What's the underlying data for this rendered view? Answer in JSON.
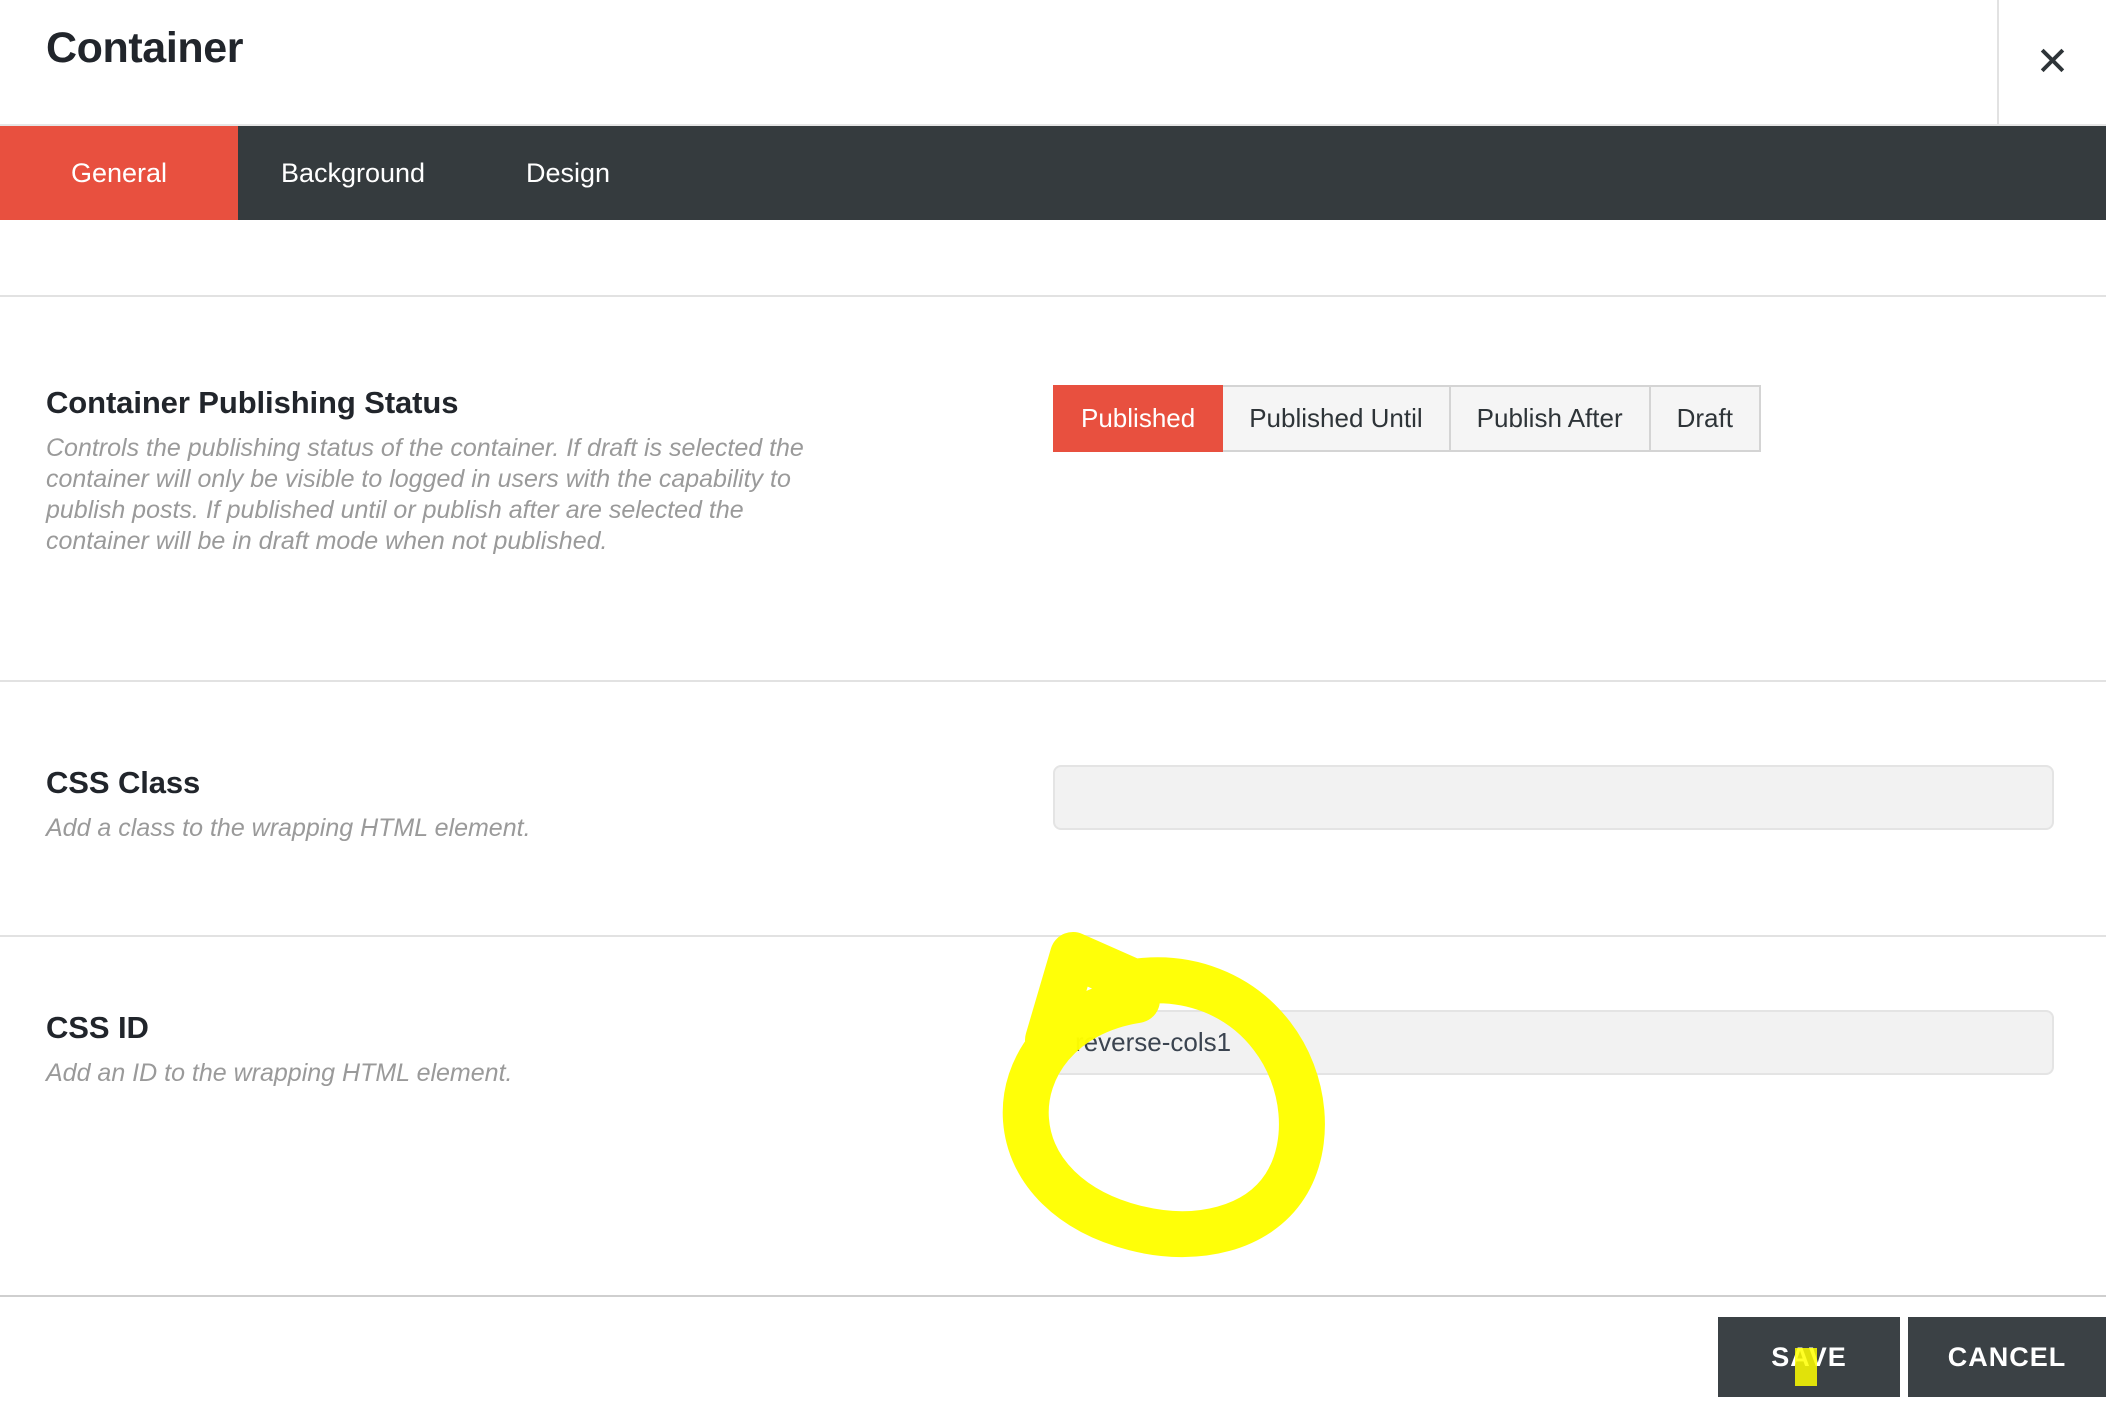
{
  "header": {
    "title": "Container",
    "close_icon": "close-icon",
    "close_label": "✕"
  },
  "tabs": [
    {
      "label": "General",
      "active": true
    },
    {
      "label": "Background",
      "active": false
    },
    {
      "label": "Design",
      "active": false
    }
  ],
  "sections": [
    {
      "id": "publishing-status",
      "label": "Container Publishing Status",
      "description": "Controls the publishing status of the container. If draft is selected the container will only be visible to logged in users with the capability to publish posts. If published until or publish after are selected the container will be in draft mode when not published.",
      "control": "button-group",
      "options": [
        {
          "label": "Published",
          "selected": true
        },
        {
          "label": "Published Until",
          "selected": false
        },
        {
          "label": "Publish After",
          "selected": false
        },
        {
          "label": "Draft",
          "selected": false
        }
      ]
    },
    {
      "id": "css-class",
      "label": "CSS Class",
      "description": "Add a class to the wrapping HTML element.",
      "control": "text-input",
      "value": "",
      "placeholder": ""
    },
    {
      "id": "css-id",
      "label": "CSS ID",
      "description": "Add an ID to the wrapping HTML element.",
      "control": "text-input",
      "value": "reverse-cols1",
      "placeholder": ""
    }
  ],
  "footer": {
    "save_label": "SAVE",
    "save_label_pre": "S",
    "save_label_hl": "A",
    "save_label_post": "VE",
    "cancel_label": "CANCEL"
  },
  "annotations": {
    "marker_color": "#ffff00",
    "circle_target": "css-id-input",
    "note": "hand-drawn yellow circle around the CSS ID value"
  },
  "colors": {
    "accent_red": "#e8503f",
    "tab_bar_dark": "#353b3e",
    "footer_button_dark": "#3b4145",
    "text_dark": "#21252b",
    "text_muted": "#9a9a9a",
    "input_bg": "#f2f2f2",
    "divider": "#e2e2e2",
    "marker_yellow": "#ffff00"
  }
}
